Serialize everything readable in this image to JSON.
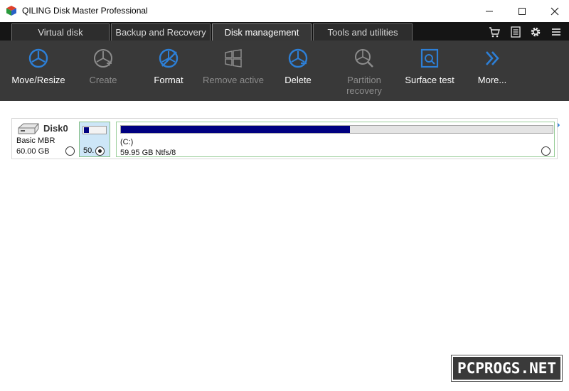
{
  "window": {
    "title": "QILING Disk Master Professional",
    "minimize_icon": "minimize-icon",
    "maximize_icon": "maximize-icon",
    "close_icon": "close-icon"
  },
  "tabs": [
    {
      "label": "Virtual disk",
      "active": false
    },
    {
      "label": "Backup and Recovery",
      "active": false
    },
    {
      "label": "Disk management",
      "active": true
    },
    {
      "label": "Tools and utilities",
      "active": false
    }
  ],
  "strip_icons": [
    "cart-icon",
    "list-icon",
    "gear-icon",
    "menu-icon"
  ],
  "toolbar": {
    "accent": "#2d7fd6",
    "items": [
      {
        "label": "Move/Resize",
        "enabled": true,
        "icon": "move-resize-icon"
      },
      {
        "label": "Create",
        "enabled": false,
        "icon": "create-icon"
      },
      {
        "label": "Format",
        "enabled": true,
        "icon": "format-icon"
      },
      {
        "label": "Remove active",
        "enabled": false,
        "icon": "remove-active-icon"
      },
      {
        "label": "Delete",
        "enabled": true,
        "icon": "delete-icon"
      },
      {
        "label": "Partition recovery",
        "enabled": false,
        "icon": "partition-recovery-icon"
      },
      {
        "label": "Surface test",
        "enabled": true,
        "icon": "surface-test-icon"
      },
      {
        "label": "More...",
        "enabled": true,
        "icon": "more-icon"
      }
    ]
  },
  "disk": {
    "name": "Disk0",
    "type": "Basic MBR",
    "size": "60.00 GB",
    "partitions": [
      {
        "label": "50.",
        "used_fraction": 0.22,
        "selected": true
      },
      {
        "drive": "(C:)",
        "info": "59.95 GB Ntfs/8",
        "used_fraction": 0.53,
        "selected": false
      }
    ]
  },
  "watermark": "PCPROGS.NET"
}
